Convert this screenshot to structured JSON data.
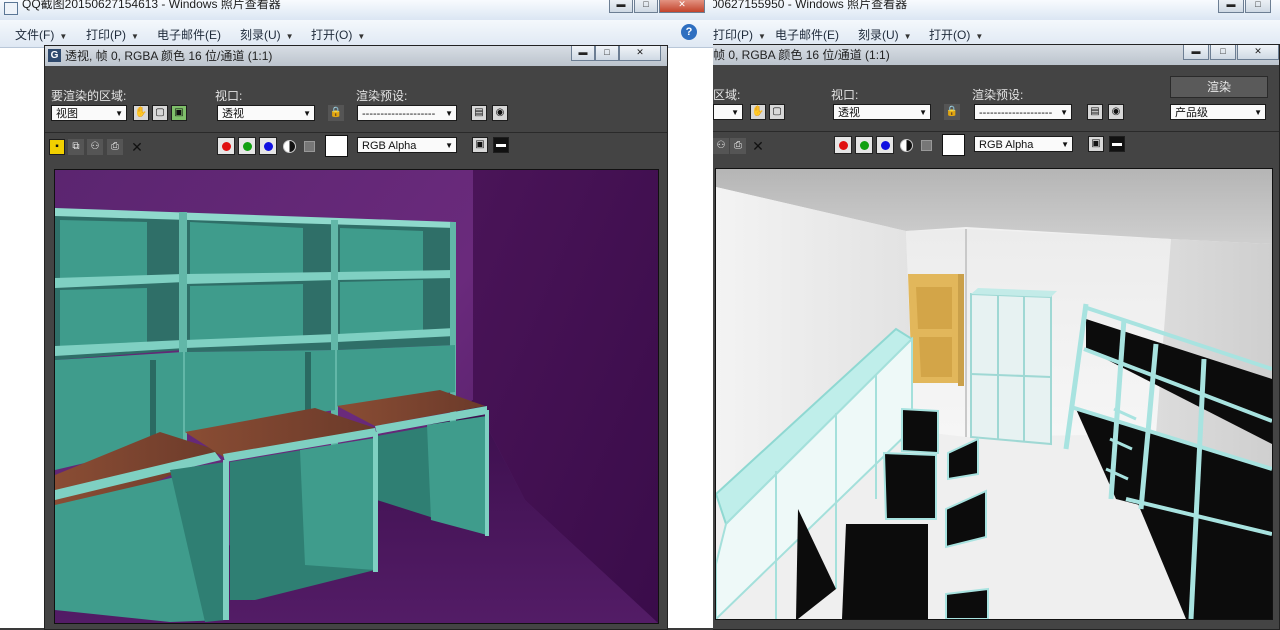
{
  "left_viewer": {
    "title": "QQ截图20150627154613 - Windows 照片查看器",
    "menu": [
      {
        "label": "文件(F)",
        "chevron": "▼"
      },
      {
        "label": "打印(P)",
        "chevron": "▼"
      },
      {
        "label": "电子邮件(E)",
        "chevron": ""
      },
      {
        "label": "刻录(U)",
        "chevron": "▼"
      },
      {
        "label": "打开(O)",
        "chevron": "▼"
      }
    ],
    "help_icon": "?"
  },
  "right_viewer": {
    "title": "00627155950 - Windows 照片查看器",
    "menu": [
      {
        "label": "打印(P)",
        "chevron": "▼"
      },
      {
        "label": "电子邮件(E)",
        "chevron": ""
      },
      {
        "label": "刻录(U)",
        "chevron": "▼"
      },
      {
        "label": "打开(O)",
        "chevron": "▼"
      }
    ]
  },
  "left_frame": {
    "title": "透视, 帧 0, RGBA 颜色 16 位/通道 (1:1)",
    "area_label": "要渲染的区域:",
    "area_value": "视图",
    "viewport_label": "视口:",
    "viewport_value": "透视",
    "preset_label": "渲染预设:",
    "preset_value": "--------------------",
    "channel_value": "RGB Alpha",
    "app_icon": "G"
  },
  "right_frame": {
    "title": "帧 0, RGBA 颜色 16 位/通道 (1:1)",
    "area_label": "区域:",
    "viewport_label": "视口:",
    "viewport_value": "透视",
    "preset_label": "渲染预设:",
    "preset_value": "--------------------",
    "render_label": "渲染",
    "quality_value": "产品级",
    "channel_value": "RGB Alpha"
  },
  "caption_buttons": {
    "minimize": "▬",
    "maximize": "□",
    "close": "✕"
  },
  "dropdown_arrow": "▼",
  "colors": {
    "purple_wall": "#5a1d6a",
    "cabinet": "#3f9c8c",
    "room_light": "#d6d6d6",
    "door": "#e2b75b",
    "bed_frame": "#a8e3e0"
  }
}
